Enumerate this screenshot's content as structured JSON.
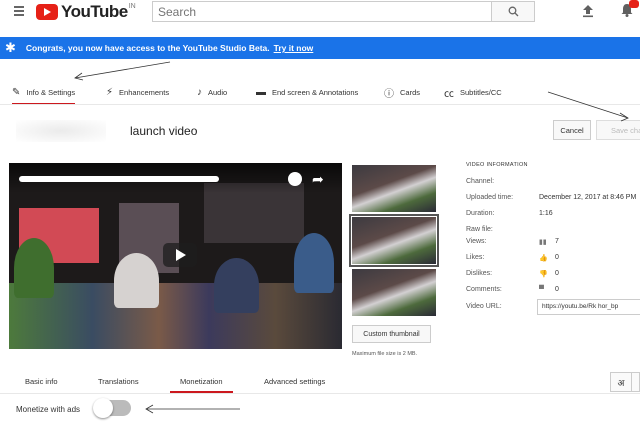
{
  "header": {
    "logo_text": "YouTube",
    "logo_country": "IN",
    "search_placeholder": "Search",
    "icons": [
      "menu-icon",
      "search-icon",
      "upload-icon",
      "bell-icon"
    ]
  },
  "banner": {
    "message": "Congrats, you now have access to the YouTube Studio Beta.",
    "link": "Try it now",
    "color": "#1a73e8"
  },
  "tabs": [
    {
      "label": "Info & Settings",
      "icon": "pencil-icon",
      "active": true
    },
    {
      "label": "Enhancements",
      "icon": "magic-wand-icon",
      "active": false
    },
    {
      "label": "Audio",
      "icon": "music-note-icon",
      "active": false
    },
    {
      "label": "End screen & Annotations",
      "icon": "end-screen-icon",
      "active": false
    },
    {
      "label": "Cards",
      "icon": "info-icon",
      "active": false
    },
    {
      "label": "Subtitles/CC",
      "icon": "cc-icon",
      "active": false
    }
  ],
  "video": {
    "title": "launch video"
  },
  "actions": {
    "cancel": "Cancel",
    "save": "Save cha"
  },
  "thumbnails": {
    "custom_button": "Custom thumbnail",
    "note": "Maximum file size is 2 MB."
  },
  "video_info": {
    "heading": "VIDEO INFORMATION",
    "channel_label": "Channel:",
    "uploaded_label": "Uploaded time:",
    "uploaded_value": "December 12, 2017 at 8:46 PM",
    "duration_label": "Duration:",
    "duration_value": "1:16",
    "raw_label": "Raw file:",
    "views_label": "Views:",
    "views_value": "7",
    "likes_label": "Likes:",
    "likes_value": "0",
    "dislikes_label": "Dislikes:",
    "dislikes_value": "0",
    "comments_label": "Comments:",
    "comments_value": "0",
    "url_label": "Video URL:",
    "url_value": "https://youtu.be/Rk  hor_bp"
  },
  "lower_tabs": [
    {
      "label": "Basic info",
      "active": false
    },
    {
      "label": "Translations",
      "active": false
    },
    {
      "label": "Monetization",
      "active": true
    },
    {
      "label": "Advanced settings",
      "active": false
    }
  ],
  "language_button": "अ",
  "monetize": {
    "label": "Monetize with ads",
    "enabled": false
  },
  "accent_color": "#cc181e"
}
